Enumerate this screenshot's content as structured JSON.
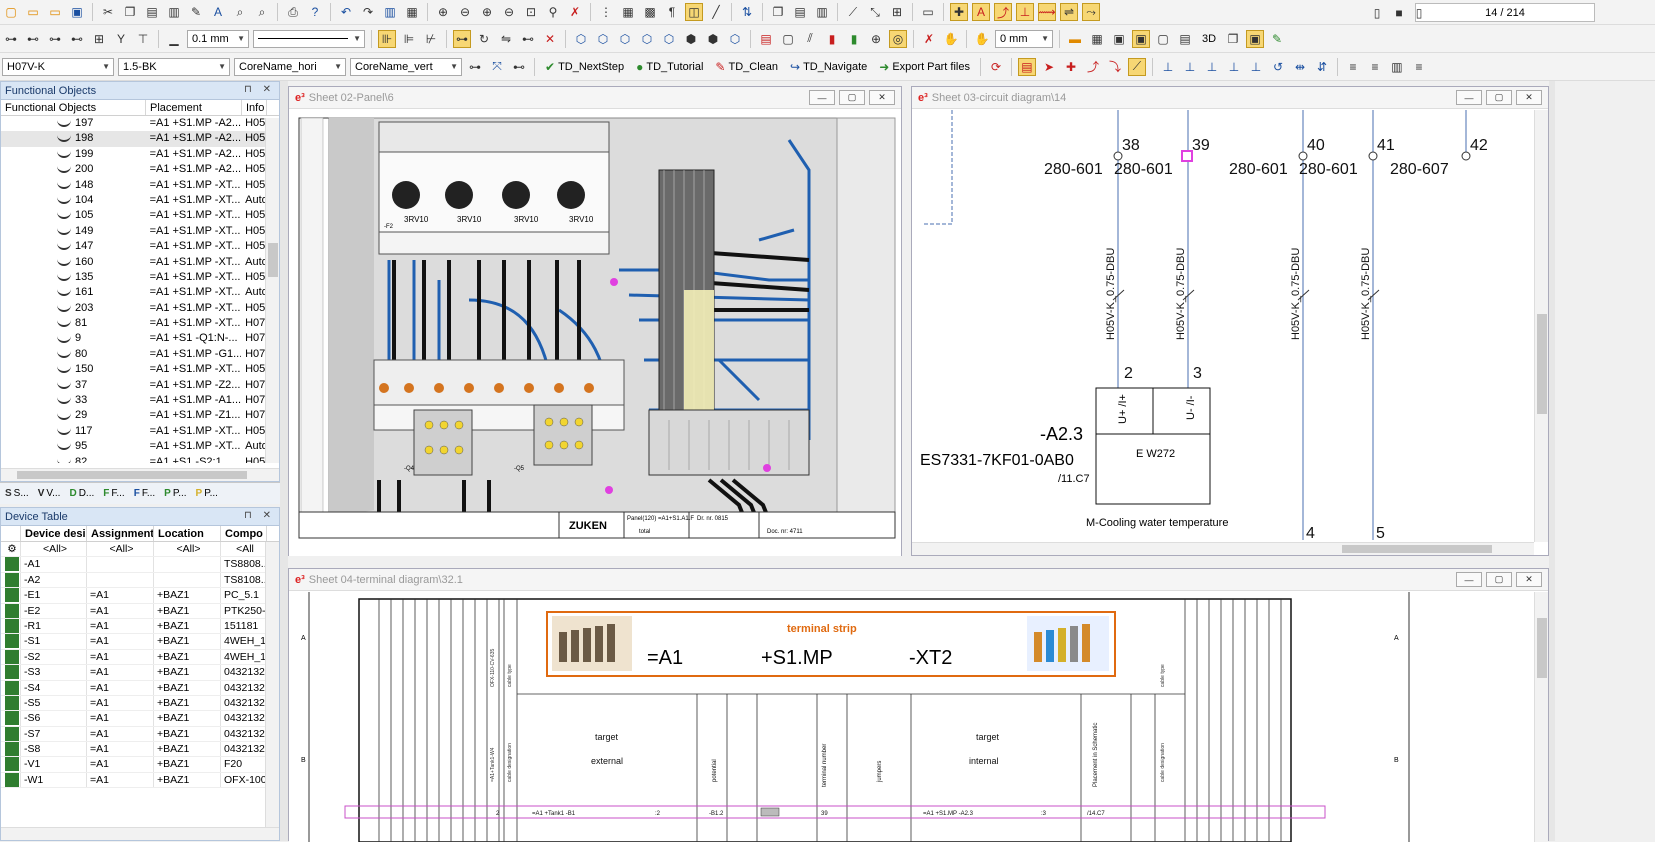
{
  "toolbar": {
    "wire_type": "H07V-K",
    "cross_section": "1.5-BK",
    "core_name_hori": "CoreName_hori",
    "core_name_vert": "CoreName_vert",
    "line_width": "0.1 mm",
    "offset": "0 mm",
    "page_indicator": "14 / 214",
    "btn_3d": "3D",
    "buttons": {
      "next_step": "TD_NextStep",
      "tutorial": "TD_Tutorial",
      "clean": "TD_Clean",
      "navigate": "TD_Navigate",
      "export_parts": "Export Part files"
    }
  },
  "functional_objects": {
    "title": "Functional Objects",
    "columns": [
      "Functional Objects",
      "Placement",
      "Info"
    ],
    "rows": [
      {
        "id": "197",
        "placement": "=A1 +S1.MP -A2...",
        "info": "H05"
      },
      {
        "id": "198",
        "placement": "=A1 +S1.MP -A2...",
        "info": "H05",
        "selected": true
      },
      {
        "id": "199",
        "placement": "=A1 +S1.MP -A2...",
        "info": "H05"
      },
      {
        "id": "200",
        "placement": "=A1 +S1.MP -A2...",
        "info": "H05"
      },
      {
        "id": "148",
        "placement": "=A1 +S1.MP -XT...",
        "info": "H05"
      },
      {
        "id": "104",
        "placement": "=A1 +S1.MP -XT...",
        "info": "Auto"
      },
      {
        "id": "105",
        "placement": "=A1 +S1.MP -XT...",
        "info": "H05"
      },
      {
        "id": "149",
        "placement": "=A1 +S1.MP -XT...",
        "info": "H05"
      },
      {
        "id": "147",
        "placement": "=A1 +S1.MP -XT...",
        "info": "H05"
      },
      {
        "id": "160",
        "placement": "=A1 +S1.MP -XT...",
        "info": "Auto"
      },
      {
        "id": "135",
        "placement": "=A1 +S1.MP -XT...",
        "info": "H05"
      },
      {
        "id": "161",
        "placement": "=A1 +S1.MP -XT...",
        "info": "Auto"
      },
      {
        "id": "203",
        "placement": "=A1 +S1.MP -XT...",
        "info": "H05"
      },
      {
        "id": "81",
        "placement": "=A1 +S1.MP -XT...",
        "info": "H07"
      },
      {
        "id": "9",
        "placement": "=A1 +S1 -Q1:N-...",
        "info": "H07"
      },
      {
        "id": "80",
        "placement": "=A1 +S1.MP -G1...",
        "info": "H07"
      },
      {
        "id": "150",
        "placement": "=A1 +S1.MP -XT...",
        "info": "H05"
      },
      {
        "id": "37",
        "placement": "=A1 +S1.MP -Z2...",
        "info": "H07"
      },
      {
        "id": "33",
        "placement": "=A1 +S1.MP -A1...",
        "info": "H07"
      },
      {
        "id": "29",
        "placement": "=A1 +S1.MP -Z1...",
        "info": "H07"
      },
      {
        "id": "117",
        "placement": "=A1 +S1.MP -XT...",
        "info": "H05"
      },
      {
        "id": "95",
        "placement": "=A1 +S1.MP -XT...",
        "info": "Auto"
      },
      {
        "id": "82",
        "placement": "=A1 +S1 -S2:1...",
        "info": "H05"
      }
    ]
  },
  "panel_tabs": [
    {
      "icon": "S",
      "label": "S..."
    },
    {
      "icon": "V",
      "label": "V..."
    },
    {
      "icon": "D",
      "label": "D..."
    },
    {
      "icon": "F",
      "label": "F..."
    },
    {
      "icon": "F",
      "label": "F..."
    },
    {
      "icon": "P",
      "label": "P..."
    },
    {
      "icon": "P",
      "label": "P..."
    }
  ],
  "device_table": {
    "title": "Device Table",
    "columns": [
      "Device desi",
      "Assignment",
      "Location",
      "Compo"
    ],
    "filter": [
      "<All>",
      "<All>",
      "<All>",
      "<All"
    ],
    "rows": [
      {
        "device": "-A1",
        "assignment": "",
        "location": "",
        "component": "TS8808..."
      },
      {
        "device": "-A2",
        "assignment": "",
        "location": "",
        "component": "TS8108..."
      },
      {
        "device": "-E1",
        "assignment": "=A1",
        "location": "+BAZ1",
        "component": "PC_5.1"
      },
      {
        "device": "-E2",
        "assignment": "=A1",
        "location": "+BAZ1",
        "component": "PTK250-..."
      },
      {
        "device": "-R1",
        "assignment": "=A1",
        "location": "+BAZ1",
        "component": "151181"
      },
      {
        "device": "-S1",
        "assignment": "=A1",
        "location": "+BAZ1",
        "component": "4WEH_1..."
      },
      {
        "device": "-S2",
        "assignment": "=A1",
        "location": "+BAZ1",
        "component": "4WEH_1..."
      },
      {
        "device": "-S3",
        "assignment": "=A1",
        "location": "+BAZ1",
        "component": "0432132..."
      },
      {
        "device": "-S4",
        "assignment": "=A1",
        "location": "+BAZ1",
        "component": "0432132..."
      },
      {
        "device": "-S5",
        "assignment": "=A1",
        "location": "+BAZ1",
        "component": "0432132..."
      },
      {
        "device": "-S6",
        "assignment": "=A1",
        "location": "+BAZ1",
        "component": "0432132..."
      },
      {
        "device": "-S7",
        "assignment": "=A1",
        "location": "+BAZ1",
        "component": "0432132..."
      },
      {
        "device": "-S8",
        "assignment": "=A1",
        "location": "+BAZ1",
        "component": "0432132..."
      },
      {
        "device": "-V1",
        "assignment": "=A1",
        "location": "+BAZ1",
        "component": "F20"
      },
      {
        "device": "-W1",
        "assignment": "=A1",
        "location": "+BAZ1",
        "component": "OFX-100..."
      }
    ]
  },
  "sheet_panel": {
    "title": "Sheet 02-Panel\\6",
    "title_block": {
      "company": "ZUKEN",
      "panel_ref": "Panel(120) =A1+S1.A1.F",
      "total": "total",
      "drawing_nr": "Dr. nr. 0815",
      "doc_nr": "Doc. nr: 4711"
    },
    "breaker_labels": [
      "3RV10",
      "3RV10",
      "3RV10",
      "3RV10"
    ],
    "small_labels": [
      "-F2",
      "-Q4",
      "-Q5"
    ]
  },
  "sheet_circuit": {
    "title": "Sheet 03-circuit diagram\\14",
    "columns": [
      {
        "number": "38",
        "ref": "280-601",
        "wire": "H05V-K_0.75-DBU",
        "bottom": "2"
      },
      {
        "number": "39",
        "ref": "280-601",
        "wire": "H05V-K_0.75-DBU",
        "bottom": "3"
      },
      {
        "number": "40",
        "ref": "280-601",
        "wire": "H05V-K_0.75-DBU",
        "bottom": "4"
      },
      {
        "number": "41",
        "ref": "280-601",
        "wire": "H05V-K_0.75-DBU",
        "bottom": "5"
      },
      {
        "number": "42",
        "ref": "280-607"
      }
    ],
    "device_id": "-A2.3",
    "part_number": "ES7331-7KF01-0AB0",
    "cross_ref": "/11.C7",
    "pin_left": "U+ /I+",
    "pin_right": "U- /I-",
    "device_type": "E W272",
    "description": "M-Cooling water temperature"
  },
  "sheet_terminal": {
    "title": "Sheet 04-terminal diagram\\32.1",
    "strip_title": "terminal strip",
    "assignment": "=A1",
    "location": "+S1.MP",
    "strip_name": "-XT2",
    "headers": {
      "target_external_1": "target",
      "target_external_2": "external",
      "potential": "potential",
      "terminal_number": "terminal number",
      "jumpers": "jumpers",
      "target_internal_1": "target",
      "target_internal_2": "internal",
      "placement": "Placement in Schematic",
      "cable_designation": "cable designation",
      "cable_type": "cable type",
      "ofx_ref": "OFX-110-CV-635",
      "tank_ref": "=A1+Tank1-W4"
    },
    "row": {
      "ext": "=A1 +Tank1 -B1",
      "ext_pin": ":2",
      "potential": "-B1.2",
      "terminal": "39",
      "int": "=A1 +S1.MP -A2.3",
      "int_pin": ":3",
      "placement": "/14.C7",
      "cable": "2"
    },
    "border_labels": [
      "A",
      "B"
    ]
  }
}
